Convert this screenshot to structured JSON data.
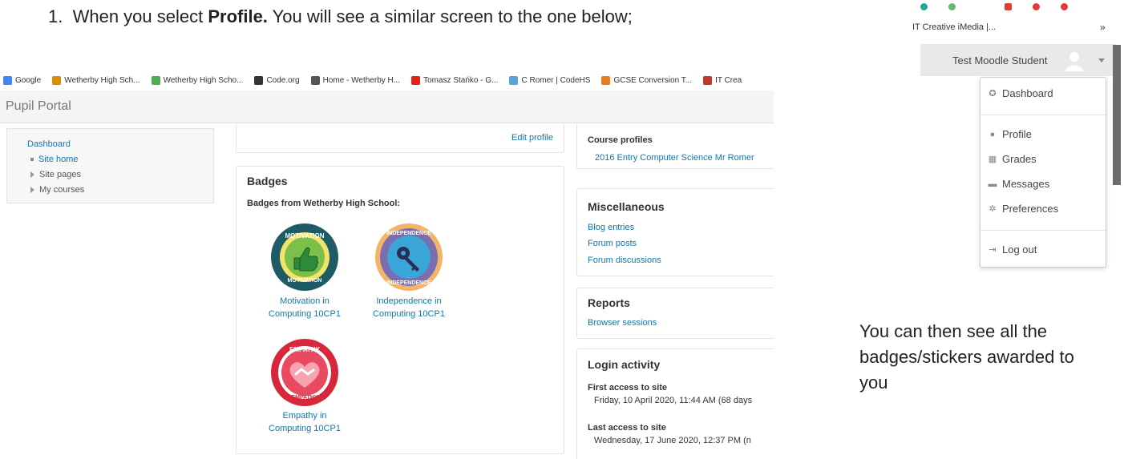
{
  "heading": {
    "number": "1.",
    "before": "When you select ",
    "bold": "Profile.",
    "after": " You will see a similar screen to the one below;"
  },
  "bookmarks": [
    {
      "label": "Google",
      "icon": "google-icon",
      "color": "#4285f4"
    },
    {
      "label": "Wetherby High Sch...",
      "icon": "school-crest-icon",
      "color": "#e08a00"
    },
    {
      "label": "Wetherby High Scho...",
      "icon": "leaf-icon",
      "color": "#4caf50"
    },
    {
      "label": "Code.org",
      "icon": "code-org-icon",
      "color": "#333333"
    },
    {
      "label": "Home - Wetherby H...",
      "icon": "globe-icon",
      "color": "#555555"
    },
    {
      "label": "Tomasz Stańko - G...",
      "icon": "youtube-icon",
      "color": "#e62117"
    },
    {
      "label": "C Romer | CodeHS",
      "icon": "codehs-icon",
      "color": "#57a4d8"
    },
    {
      "label": "GCSE Conversion T...",
      "icon": "ring-icon",
      "color": "#e67e22"
    },
    {
      "label": "IT Crea",
      "icon": "it-creative-icon",
      "color": "#c0392b"
    }
  ],
  "portal_title": "Pupil Portal",
  "leftnav": {
    "dashboard": "Dashboard",
    "site_home": "Site home",
    "site_pages": "Site pages",
    "my_courses": "My courses"
  },
  "edit_profile": "Edit profile",
  "badges": {
    "title": "Badges",
    "subtitle": "Badges from Wetherby High School:",
    "items": [
      {
        "line1": "Motivation in",
        "line2": "Computing 10CP1",
        "word": "MOTIVATION"
      },
      {
        "line1": "Independence in",
        "line2": "Computing 10CP1",
        "word": "INDEPENDENCE"
      },
      {
        "line1": "Empathy in",
        "line2": "Computing 10CP1",
        "word": "EMPATHY"
      }
    ]
  },
  "course_profiles": {
    "title": "Course profiles",
    "link": "2016 Entry Computer Science Mr Romer"
  },
  "misc": {
    "title": "Miscellaneous",
    "blog": "Blog entries",
    "forum_posts": "Forum posts",
    "forum_discussions": "Forum discussions"
  },
  "reports": {
    "title": "Reports",
    "browser_sessions": "Browser sessions"
  },
  "login": {
    "title": "Login activity",
    "first_label": "First access to site",
    "first_value": "Friday, 10 April 2020, 11:44 AM  (68 days",
    "last_label": "Last access to site",
    "last_value": "Wednesday, 17 June 2020, 12:37 PM  (n"
  },
  "dropdown": {
    "tab_text": "IT Creative iMedia |...",
    "chevron": "»",
    "username": "Test Moodle Student",
    "items": {
      "dashboard": "Dashboard",
      "profile": "Profile",
      "grades": "Grades",
      "messages": "Messages",
      "preferences": "Preferences",
      "logout": "Log out"
    }
  },
  "side_note": "You can then see all the badges/stickers awarded to you",
  "colors": {
    "link": "#1177aa",
    "motivation": "#1e5b66",
    "independence": "#f0a050",
    "empathy": "#d6283a"
  }
}
